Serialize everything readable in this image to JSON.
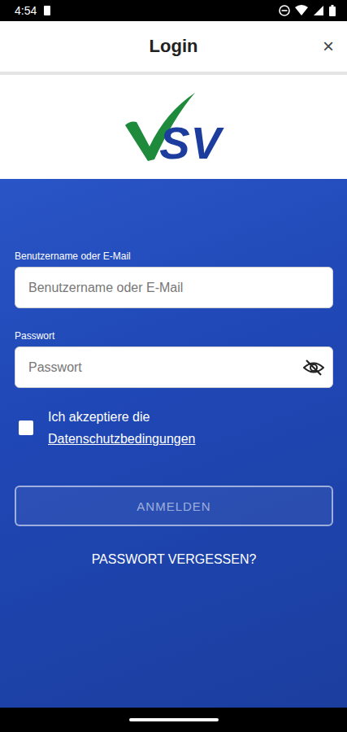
{
  "status_bar": {
    "time": "4:54"
  },
  "header": {
    "title": "Login",
    "close": "×"
  },
  "logo": {
    "text": "SV"
  },
  "form": {
    "username": {
      "label": "Benutzername oder E-Mail",
      "placeholder": "Benutzername oder E-Mail"
    },
    "password": {
      "label": "Passwort",
      "placeholder": "Passwort",
      "visible": false
    },
    "privacy": {
      "text": "Ich akzeptiere die",
      "link": "Datenschutzbedingungen",
      "checked": false
    },
    "submit": {
      "label": "ANMELDEN",
      "disabled": true
    },
    "forgot": "PASSWORT VERGESSEN?"
  }
}
